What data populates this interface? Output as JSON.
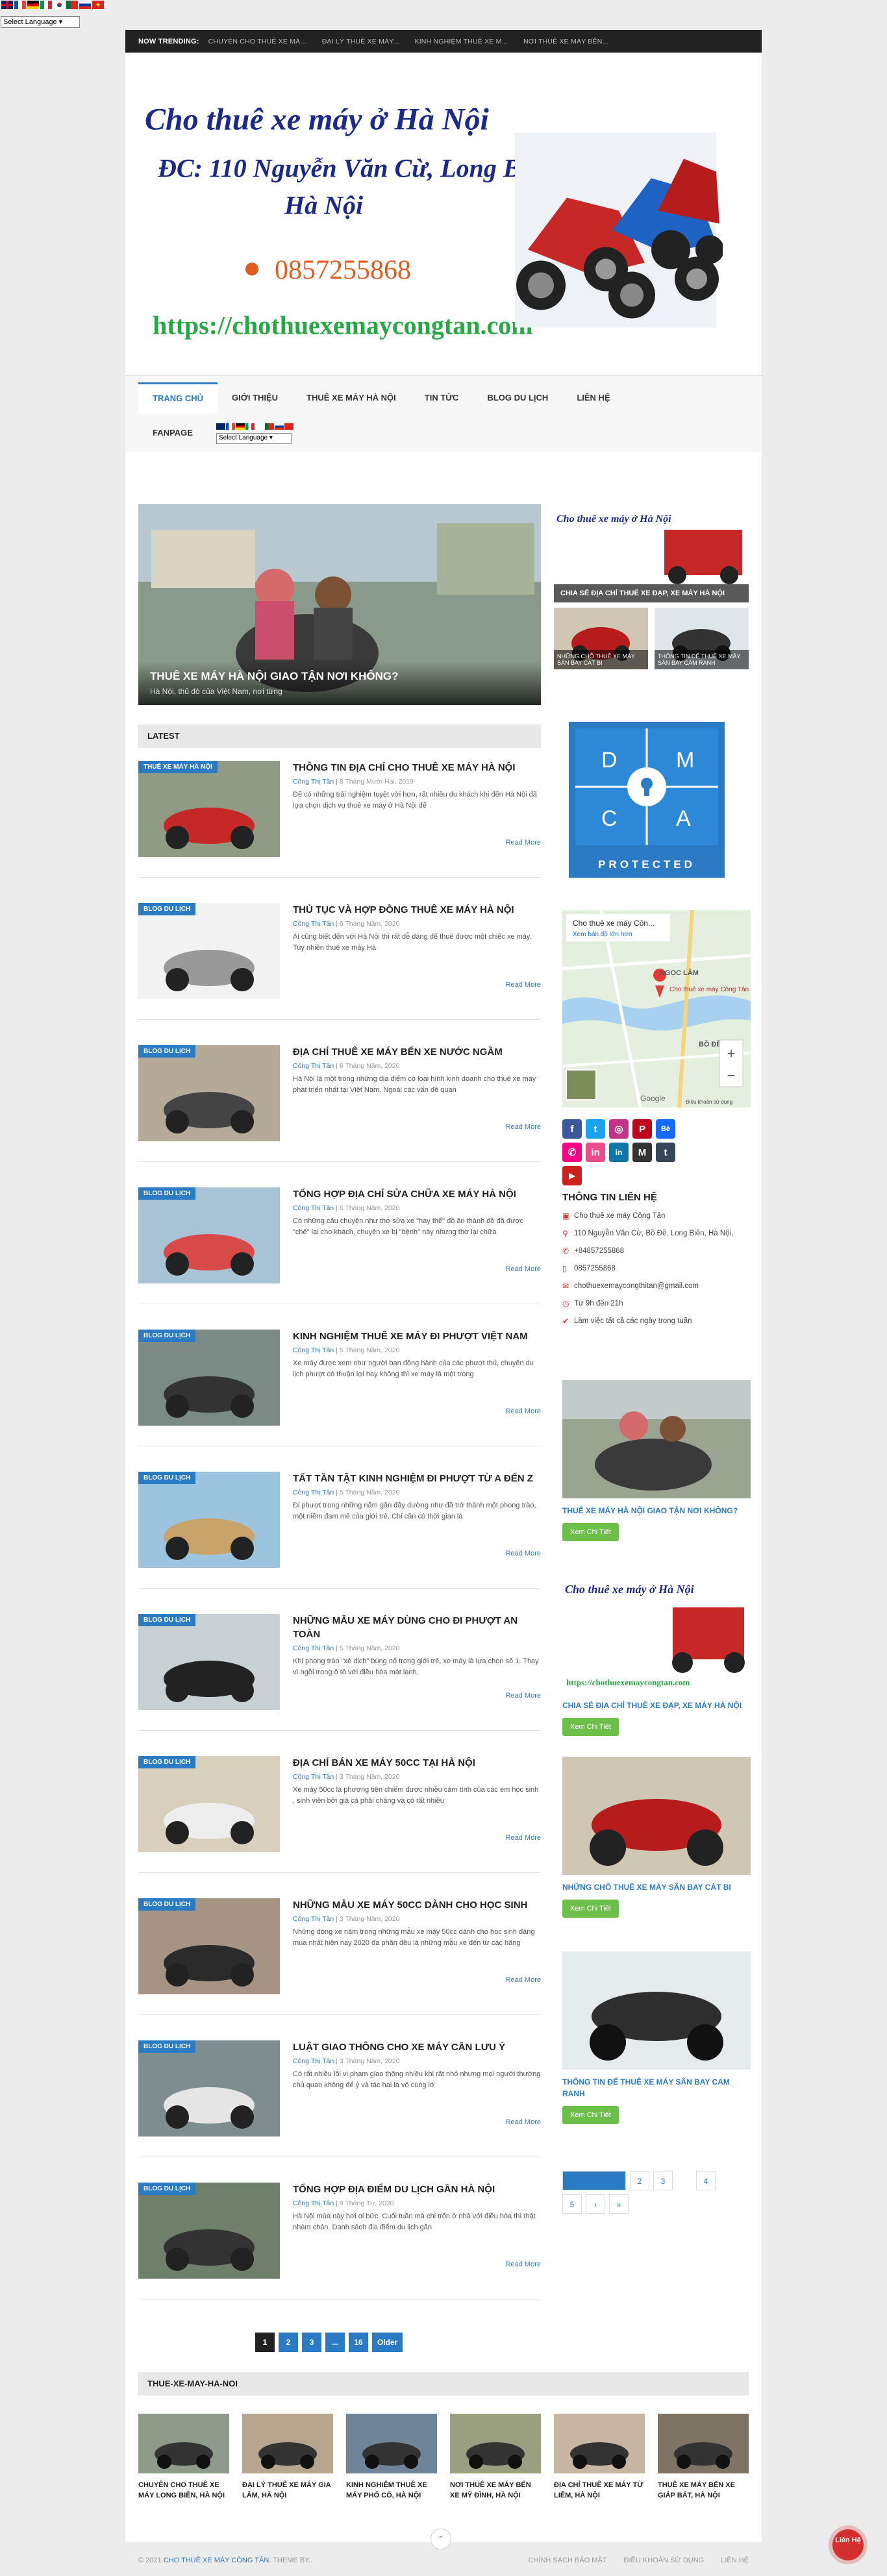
{
  "translator": {
    "select_label": "Select Language",
    "flags": [
      "flag-en-icon",
      "flag-fr-icon",
      "flag-de-icon",
      "flag-it-icon",
      "flag-pt-icon",
      "flag-ko-icon",
      "flag-ru-icon",
      "flag-vn-icon"
    ]
  },
  "topbar": {
    "label": "NOW TRENDING:",
    "items": [
      "CHUYÊN CHO THUÊ XE MÁ...",
      "ĐẠI LÝ THUÊ XE MÁY...",
      "KINH NGHIỆM THUÊ XE M...",
      "NƠI THUÊ XE MÁY BẾN..."
    ]
  },
  "banner": {
    "title": "Cho thuê xe máy ở Hà Nội",
    "address": "ĐC: 110 Nguyễn Văn Cừ, Long Biên",
    "city": "Hà Nội",
    "phone": "0857255868",
    "url": "https://chothuexemaycongtan.com"
  },
  "nav": {
    "items": [
      "TRANG CHỦ",
      "GIỚI THIỆU",
      "THUÊ XE MÁY HÀ NỘI",
      "TIN TỨC",
      "BLOG DU LỊCH",
      "LIÊN HỆ"
    ],
    "fanpage": "FANPAGE",
    "select_label": "Select Language"
  },
  "featured": {
    "title": "THUÊ XE MÁY HÀ NỘI GIAO TẬN NƠI KHÔNG?",
    "excerpt": "Hà Nội, thủ đô của Việt Nam, nơi từng",
    "side_top": "CHIA SẺ ĐỊA CHỈ THUÊ XE ĐẠP, XE MÁY HÀ NỘI",
    "side_small_1": "NHỮNG CHỖ THUÊ XE MÁY SÂN BAY CÁT BI",
    "side_small_2": "THÔNG TIN ĐỂ THUÊ XE MÁY SÂN BAY CAM RANH"
  },
  "latest": {
    "heading": "LATEST",
    "read_more": "Read More",
    "posts": [
      {
        "cat": "THUÊ XE MÁY HÀ NỘI",
        "title": "THÔNG TIN ĐỊA CHỈ CHO THUÊ XE MÁY HÀ NỘI",
        "author": "Công Thị Tân",
        "date": "8 Tháng Mười Hai, 2019",
        "excerpt": "Để có những trải nghiệm tuyệt vời hơn, rất nhiều du khách khi đến Hà Nội đã lựa chọn dịch vụ thuê xe máy ở Hà Nội để"
      },
      {
        "cat": "BLOG DU LỊCH",
        "title": "THỦ TỤC VÀ HỢP ĐỒNG THUÊ XE MÁY HÀ NỘI",
        "author": "Công Thị Tân",
        "date": "6 Tháng Năm, 2020",
        "excerpt": "Ai cũng biết đến với Hà Nội thì rất dễ dàng để thuê được một chiếc xe máy. Tuy nhiên thuê xe máy Hà"
      },
      {
        "cat": "BLOG DU LỊCH",
        "title": "ĐỊA CHỈ THUÊ XE MÁY BẾN XE NƯỚC NGẦM",
        "author": "Công Thị Tân",
        "date": "6 Tháng Năm, 2020",
        "excerpt": "Hà Nội là một trong những địa điểm có loại hình kinh doanh cho thuê xe máy phát triển nhất tại Việt Nam. Ngoài các vấn đề quan"
      },
      {
        "cat": "BLOG DU LỊCH",
        "title": "TỔNG HỢP ĐỊA CHỈ SỬA CHỮA XE MÁY HÀ NỘI",
        "author": "Công Thị Tân",
        "date": "6 Tháng Năm, 2020",
        "excerpt": "Có những câu chuyện như thợ sửa xe \"hay thể\" đồ ăn thành đồ đã được \"chế\" lại cho khách, chuyện xe bị \"bệnh\" này nhưng thợ lại chữa"
      },
      {
        "cat": "BLOG DU LỊCH",
        "title": "KINH NGHIỆM THUÊ XE MÁY ĐI PHƯỢT VIỆT NAM",
        "author": "Công Thị Tân",
        "date": "5 Tháng Năm, 2020",
        "excerpt": "Xe máy được xem như người bạn đồng hành của các phượt thủ, chuyến du lịch phượt có thuận lợi hay không thì xe máy là một trong"
      },
      {
        "cat": "BLOG DU LỊCH",
        "title": "TẤT TẦN TẬT KINH NGHIỆM ĐI PHƯỢT TỪ A ĐẾN Z",
        "author": "Công Thị Tân",
        "date": "5 Tháng Năm, 2020",
        "excerpt": "Đi phượt trong những năm gần đây dường như đã trở thành một phong trào, một niềm đam mê của giới trẻ. Chỉ cần có thời gian là"
      },
      {
        "cat": "BLOG DU LỊCH",
        "title": "NHỮNG MẪU XE MÁY DÙNG CHO ĐI PHƯỢT AN TOÀN",
        "author": "Công Thị Tân",
        "date": "5 Tháng Năm, 2020",
        "excerpt": "Khi phong trào \"xê dịch\" bùng nổ trong giới trẻ, xe máy là lựa chọn số 1. Thay vì ngồi trong ô tô với điều hòa mát lạnh,"
      },
      {
        "cat": "BLOG DU LỊCH",
        "title": "ĐỊA CHỈ BÁN XE MÁY 50CC TẠI HÀ NỘI",
        "author": "Công Thị Tân",
        "date": "3 Tháng Năm, 2020",
        "excerpt": "Xe máy 50cc là phương tiện chiếm được nhiều cảm tình của các em học sinh , sinh viên bởi giá cả phải chăng và có rất nhiều"
      },
      {
        "cat": "BLOG DU LỊCH",
        "title": "NHỮNG MẪU XE MÁY 50CC DÀNH CHO HỌC SINH",
        "author": "Công Thị Tân",
        "date": "3 Tháng Năm, 2020",
        "excerpt": "Những dòng xe năm trong những mẫu xe máy 50cc dành cho học sinh đáng mua nhất hiện nay 2020 đa phần đều là những mẫu xe đến từ các hãng"
      },
      {
        "cat": "BLOG DU LỊCH",
        "title": "LUẬT GIAO THÔNG CHO XE MÁY CẦN LƯU Ý",
        "author": "Công Thị Tân",
        "date": "3 Tháng Năm, 2020",
        "excerpt": "Có rất nhiều lỗi vi phạm giao thông nhiều khi rất nhỏ nhưng mọi người thường chủ quan không để ý và tác hại là vô cùng lớ"
      },
      {
        "cat": "BLOG DU LỊCH",
        "title": "TỔNG HỢP ĐỊA ĐIỂM DU LỊCH GẦN HÀ NỘI",
        "author": "Công Thị Tân",
        "date": "9 Tháng Tư, 2020",
        "excerpt": "Hà Nội mùa này hơi oi bức. Cuối tuần mà chỉ trốn ở nhà với điều hòa thì thật nhàm chán. Danh sách địa điểm du lịch gần"
      }
    ]
  },
  "pagination": {
    "pages": [
      "1",
      "2",
      "3",
      "...",
      "16",
      "Older"
    ]
  },
  "sidebar": {
    "dmca": {
      "letters": [
        "D",
        "M",
        "C",
        "A"
      ],
      "label": "PROTECTED"
    },
    "map": {
      "place": "Cho thuê xe máy Côn...",
      "link": "Xem bản đồ lớn hơn",
      "pin": "Cho thuê xe máy Công Tân",
      "area1": "NGỌC LÂM",
      "area2": "BỒ ĐỀ",
      "logo": "Google",
      "credit": "Điều khoản sử dụng"
    },
    "social": [
      "f",
      "t",
      "◎",
      "P",
      "Bē",
      "✆",
      "in",
      "M",
      "t",
      "▶"
    ],
    "contact": {
      "heading": "THÔNG TIN LIÊN HỆ",
      "rows": [
        "Cho thuê xe máy Công Tân",
        "110 Nguyễn Văn Cừ, Bồ Đề, Long Biên, Hà Nội,",
        "+84857255868",
        "0857255868",
        "chothuexemaycongthitan@gmail.com",
        "Từ 9h đến 21h",
        "Làm việc tất cả các ngày trong tuần"
      ]
    },
    "cards": [
      {
        "title": "THUÊ XE MÁY HÀ NỘI GIAO TẬN NƠI KHÔNG?",
        "btn": "Xem Chi Tiết"
      },
      {
        "title": "CHIA SẺ ĐỊA CHỈ THUÊ XE ĐẠP, XE MÁY HÀ NỘI",
        "btn": "Xem Chi Tiết"
      },
      {
        "title": "NHỮNG CHỖ THUÊ XE MÁY SÂN BAY CÁT BI",
        "btn": "Xem Chi Tiết"
      },
      {
        "title": "THÔNG TIN ĐỂ THUÊ XE MÁY SÂN BAY CAM RANH",
        "btn": "Xem Chi Tiết"
      }
    ],
    "pager": [
      "1",
      "2",
      "3",
      "4",
      "5",
      "›",
      "»"
    ]
  },
  "grid": {
    "heading": "THUE-XE-MAY-HA-NOI",
    "items": [
      "CHUYÊN CHO THUÊ XE MÁY LONG BIÊN, HÀ NỘI",
      "ĐẠI LÝ THUÊ XE MÁY GIA LÂM, HÀ NỘI",
      "KINH NGHIỆM THUÊ XE MÁY PHỐ CỔ, HÀ NỘI",
      "NƠI THUÊ XE MÁY BẾN XE MỸ ĐÌNH, HÀ NỘI",
      "ĐỊA CHỈ THUÊ XE MÁY TỪ LIÊM, HÀ NỘI",
      "THUÊ XE MÁY BẾN XE GIÁP BÁT, HÀ NỘI"
    ]
  },
  "footer": {
    "copy_prefix": "© 2021",
    "copy_brand": "CHO THUÊ XE MÁY CÔNG TÂN",
    "copy_suffix": ". THEME BY..",
    "links": [
      "CHÍNH SÁCH BẢO MẬT",
      "ĐIỀU KHOẢN SỬ DỤNG",
      "LIÊN HỆ"
    ],
    "back_top": "⌃",
    "contact_btn": "Liên Hệ"
  }
}
